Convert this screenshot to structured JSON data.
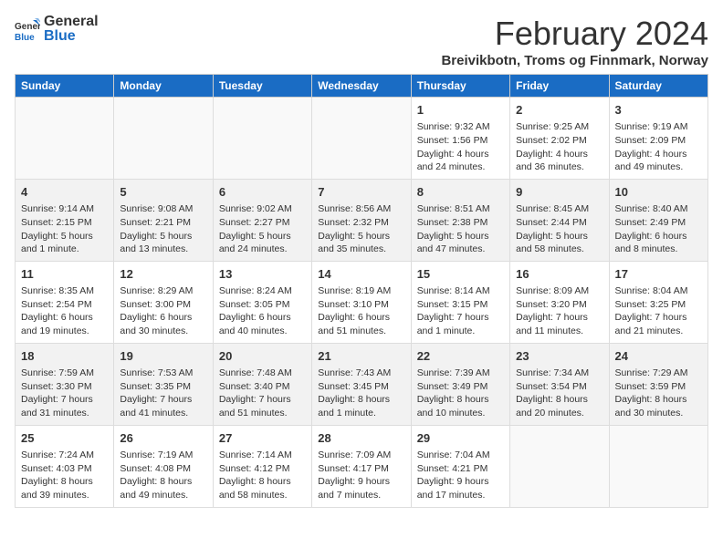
{
  "header": {
    "logo_general": "General",
    "logo_blue": "Blue",
    "month_title": "February 2024",
    "subtitle": "Breivikbotn, Troms og Finnmark, Norway"
  },
  "days_of_week": [
    "Sunday",
    "Monday",
    "Tuesday",
    "Wednesday",
    "Thursday",
    "Friday",
    "Saturday"
  ],
  "weeks": [
    [
      {
        "day": "",
        "info": ""
      },
      {
        "day": "",
        "info": ""
      },
      {
        "day": "",
        "info": ""
      },
      {
        "day": "",
        "info": ""
      },
      {
        "day": "1",
        "info": "Sunrise: 9:32 AM\nSunset: 1:56 PM\nDaylight: 4 hours\nand 24 minutes."
      },
      {
        "day": "2",
        "info": "Sunrise: 9:25 AM\nSunset: 2:02 PM\nDaylight: 4 hours\nand 36 minutes."
      },
      {
        "day": "3",
        "info": "Sunrise: 9:19 AM\nSunset: 2:09 PM\nDaylight: 4 hours\nand 49 minutes."
      }
    ],
    [
      {
        "day": "4",
        "info": "Sunrise: 9:14 AM\nSunset: 2:15 PM\nDaylight: 5 hours\nand 1 minute."
      },
      {
        "day": "5",
        "info": "Sunrise: 9:08 AM\nSunset: 2:21 PM\nDaylight: 5 hours\nand 13 minutes."
      },
      {
        "day": "6",
        "info": "Sunrise: 9:02 AM\nSunset: 2:27 PM\nDaylight: 5 hours\nand 24 minutes."
      },
      {
        "day": "7",
        "info": "Sunrise: 8:56 AM\nSunset: 2:32 PM\nDaylight: 5 hours\nand 35 minutes."
      },
      {
        "day": "8",
        "info": "Sunrise: 8:51 AM\nSunset: 2:38 PM\nDaylight: 5 hours\nand 47 minutes."
      },
      {
        "day": "9",
        "info": "Sunrise: 8:45 AM\nSunset: 2:44 PM\nDaylight: 5 hours\nand 58 minutes."
      },
      {
        "day": "10",
        "info": "Sunrise: 8:40 AM\nSunset: 2:49 PM\nDaylight: 6 hours\nand 8 minutes."
      }
    ],
    [
      {
        "day": "11",
        "info": "Sunrise: 8:35 AM\nSunset: 2:54 PM\nDaylight: 6 hours\nand 19 minutes."
      },
      {
        "day": "12",
        "info": "Sunrise: 8:29 AM\nSunset: 3:00 PM\nDaylight: 6 hours\nand 30 minutes."
      },
      {
        "day": "13",
        "info": "Sunrise: 8:24 AM\nSunset: 3:05 PM\nDaylight: 6 hours\nand 40 minutes."
      },
      {
        "day": "14",
        "info": "Sunrise: 8:19 AM\nSunset: 3:10 PM\nDaylight: 6 hours\nand 51 minutes."
      },
      {
        "day": "15",
        "info": "Sunrise: 8:14 AM\nSunset: 3:15 PM\nDaylight: 7 hours\nand 1 minute."
      },
      {
        "day": "16",
        "info": "Sunrise: 8:09 AM\nSunset: 3:20 PM\nDaylight: 7 hours\nand 11 minutes."
      },
      {
        "day": "17",
        "info": "Sunrise: 8:04 AM\nSunset: 3:25 PM\nDaylight: 7 hours\nand 21 minutes."
      }
    ],
    [
      {
        "day": "18",
        "info": "Sunrise: 7:59 AM\nSunset: 3:30 PM\nDaylight: 7 hours\nand 31 minutes."
      },
      {
        "day": "19",
        "info": "Sunrise: 7:53 AM\nSunset: 3:35 PM\nDaylight: 7 hours\nand 41 minutes."
      },
      {
        "day": "20",
        "info": "Sunrise: 7:48 AM\nSunset: 3:40 PM\nDaylight: 7 hours\nand 51 minutes."
      },
      {
        "day": "21",
        "info": "Sunrise: 7:43 AM\nSunset: 3:45 PM\nDaylight: 8 hours\nand 1 minute."
      },
      {
        "day": "22",
        "info": "Sunrise: 7:39 AM\nSunset: 3:49 PM\nDaylight: 8 hours\nand 10 minutes."
      },
      {
        "day": "23",
        "info": "Sunrise: 7:34 AM\nSunset: 3:54 PM\nDaylight: 8 hours\nand 20 minutes."
      },
      {
        "day": "24",
        "info": "Sunrise: 7:29 AM\nSunset: 3:59 PM\nDaylight: 8 hours\nand 30 minutes."
      }
    ],
    [
      {
        "day": "25",
        "info": "Sunrise: 7:24 AM\nSunset: 4:03 PM\nDaylight: 8 hours\nand 39 minutes."
      },
      {
        "day": "26",
        "info": "Sunrise: 7:19 AM\nSunset: 4:08 PM\nDaylight: 8 hours\nand 49 minutes."
      },
      {
        "day": "27",
        "info": "Sunrise: 7:14 AM\nSunset: 4:12 PM\nDaylight: 8 hours\nand 58 minutes."
      },
      {
        "day": "28",
        "info": "Sunrise: 7:09 AM\nSunset: 4:17 PM\nDaylight: 9 hours\nand 7 minutes."
      },
      {
        "day": "29",
        "info": "Sunrise: 7:04 AM\nSunset: 4:21 PM\nDaylight: 9 hours\nand 17 minutes."
      },
      {
        "day": "",
        "info": ""
      },
      {
        "day": "",
        "info": ""
      }
    ]
  ]
}
